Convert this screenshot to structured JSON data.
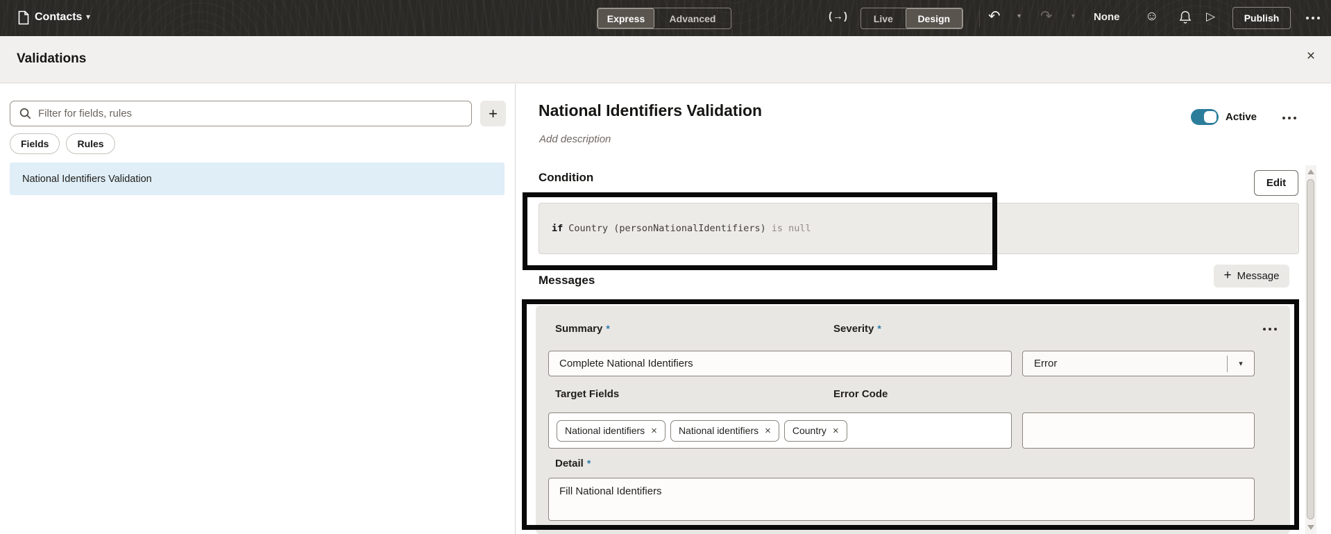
{
  "topbar": {
    "app_name": "Contacts",
    "mode_toggle": {
      "express": "Express",
      "advanced": "Advanced",
      "selected": "Express"
    },
    "view_toggle": {
      "live": "Live",
      "design": "Design",
      "selected": "Design"
    },
    "version_label": "None",
    "publish_label": "Publish"
  },
  "icons": {
    "app_caret": "▾",
    "preview_glyph": "(→)",
    "undo_glyph": "↶",
    "redo_glyph": "↷",
    "small_caret": "▾",
    "smiley_glyph": "☺",
    "play_glyph": "▷",
    "close_glyph": "×",
    "plus_glyph": "+",
    "select_caret": "▾",
    "chip_remove_glyph": "×"
  },
  "panel": {
    "title": "Validations"
  },
  "sidebar": {
    "search_placeholder": "Filter for fields, rules",
    "filters": {
      "fields": "Fields",
      "rules": "Rules"
    },
    "rule_items": [
      {
        "label": "National Identifiers Validation",
        "selected": true
      }
    ]
  },
  "detail": {
    "title": "National Identifiers Validation",
    "description_placeholder": "Add description",
    "active_label": "Active",
    "condition": {
      "heading": "Condition",
      "edit_label": "Edit",
      "expression_keyword": "if",
      "expression_clause": "Country (personNationalIdentifiers)",
      "expression_operator": "is null"
    },
    "messages": {
      "heading": "Messages",
      "add_button_label": "Message",
      "message": {
        "summary_label": "Summary",
        "required_marker": "*",
        "summary_value": "Complete National Identifiers",
        "severity_label": "Severity",
        "severity_value": "Error",
        "target_fields_label": "Target Fields",
        "target_fields": [
          "National identifiers",
          "National identifiers",
          "Country"
        ],
        "error_code_label": "Error Code",
        "error_code_value": "",
        "detail_label": "Detail",
        "detail_value": "Fill National Identifiers"
      }
    }
  },
  "colors": {
    "topbar_bg": "#2b2926",
    "accent_toggle": "#2b7d9b",
    "required_asterisk": "#2e7da6",
    "selected_item_bg": "#dfeef7",
    "annotation_border": "#090909"
  }
}
